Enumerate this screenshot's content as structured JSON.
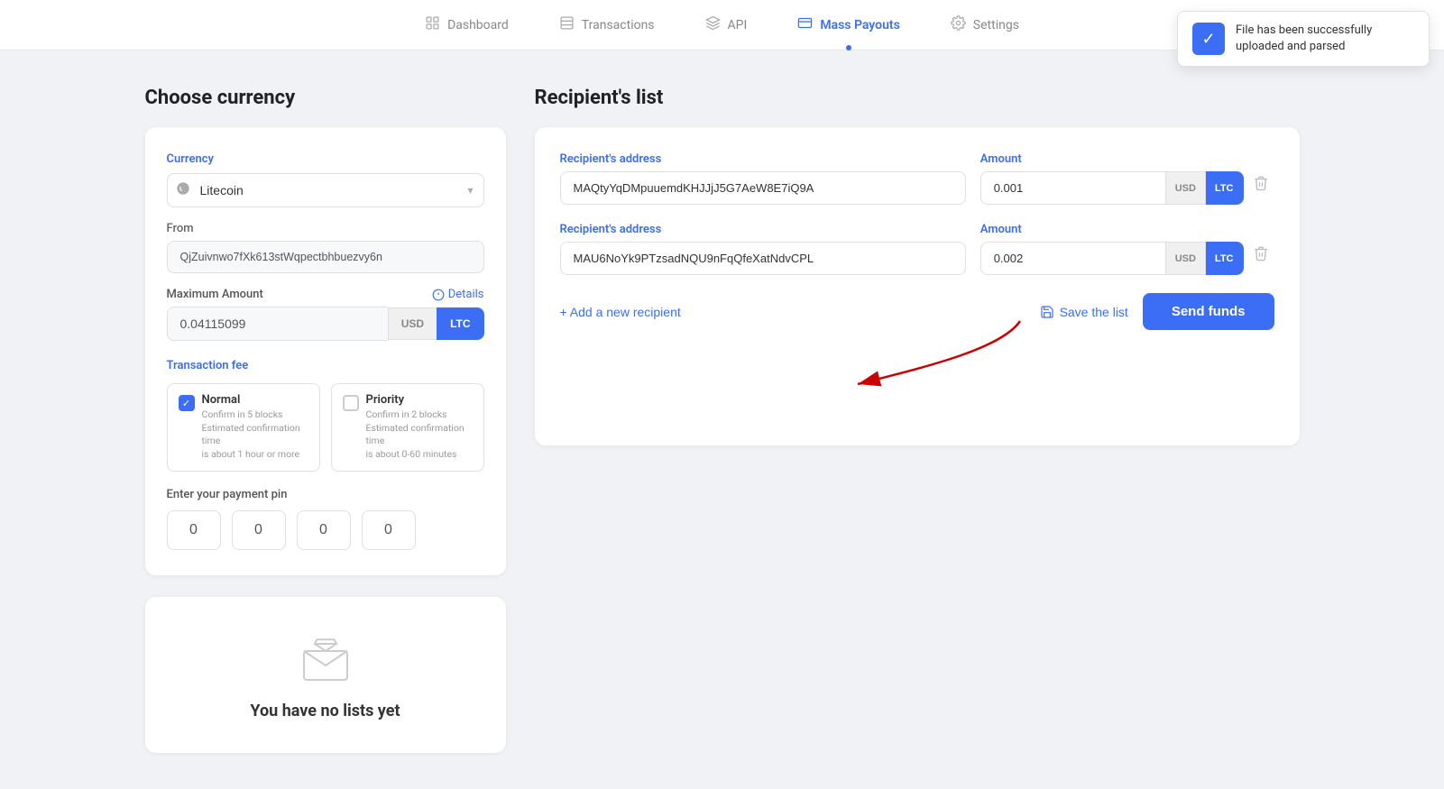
{
  "nav": {
    "items": [
      {
        "id": "dashboard",
        "label": "Dashboard",
        "icon": "🏠",
        "active": false
      },
      {
        "id": "transactions",
        "label": "Transactions",
        "icon": "📋",
        "active": false
      },
      {
        "id": "api",
        "label": "API",
        "icon": "🤝",
        "active": false
      },
      {
        "id": "mass-payouts",
        "label": "Mass Payouts",
        "icon": "💸",
        "active": true
      },
      {
        "id": "settings",
        "label": "Settings",
        "icon": "⚙️",
        "active": false
      }
    ]
  },
  "toast": {
    "message": "File has been successfully uploaded and parsed"
  },
  "left": {
    "title": "Choose currency",
    "currency_label": "Currency",
    "currency_value": "Litecoin",
    "from_label": "From",
    "from_value": "QjZuivnwo7fXk613stWqpectbhbuezvy6n",
    "max_amount_label": "Maximum Amount",
    "details_label": "Details",
    "max_amount_value": "0.04115099",
    "usd_label": "USD",
    "ltc_label": "LTC",
    "fee_label": "Transaction fee",
    "normal_fee": {
      "title": "Normal",
      "desc": "Confirm in 5 blocks\nEstimated confirmation time\nis about 1 hour or more",
      "checked": true
    },
    "priority_fee": {
      "title": "Priority",
      "desc": "Confirm in 2 blocks\nEstimated confirmation time\nis about 0-60 minutes",
      "checked": false
    },
    "pin_label": "Enter your payment pin",
    "pin_values": [
      "0",
      "0",
      "0",
      "0"
    ]
  },
  "empty_list": {
    "text": "You have no lists yet"
  },
  "right": {
    "title": "Recipient's list",
    "recipients": [
      {
        "address_label": "Recipient's address",
        "address": "MAQtyYqDMpuuemdKHJJjJ5G7AeW8E7iQ9A",
        "amount_label": "Amount",
        "amount": "0.001",
        "currency_usd": "USD",
        "currency_ltc": "LTC"
      },
      {
        "address_label": "Recipient's address",
        "address": "MAU6NoYk9PTzsadNQU9nFqQfeXatNdvCPL",
        "amount_label": "Amount",
        "amount": "0.002",
        "currency_usd": "USD",
        "currency_ltc": "LTC"
      }
    ],
    "add_recipient_label": "+ Add a new recipient",
    "save_list_label": "Save the list",
    "send_funds_label": "Send funds"
  }
}
